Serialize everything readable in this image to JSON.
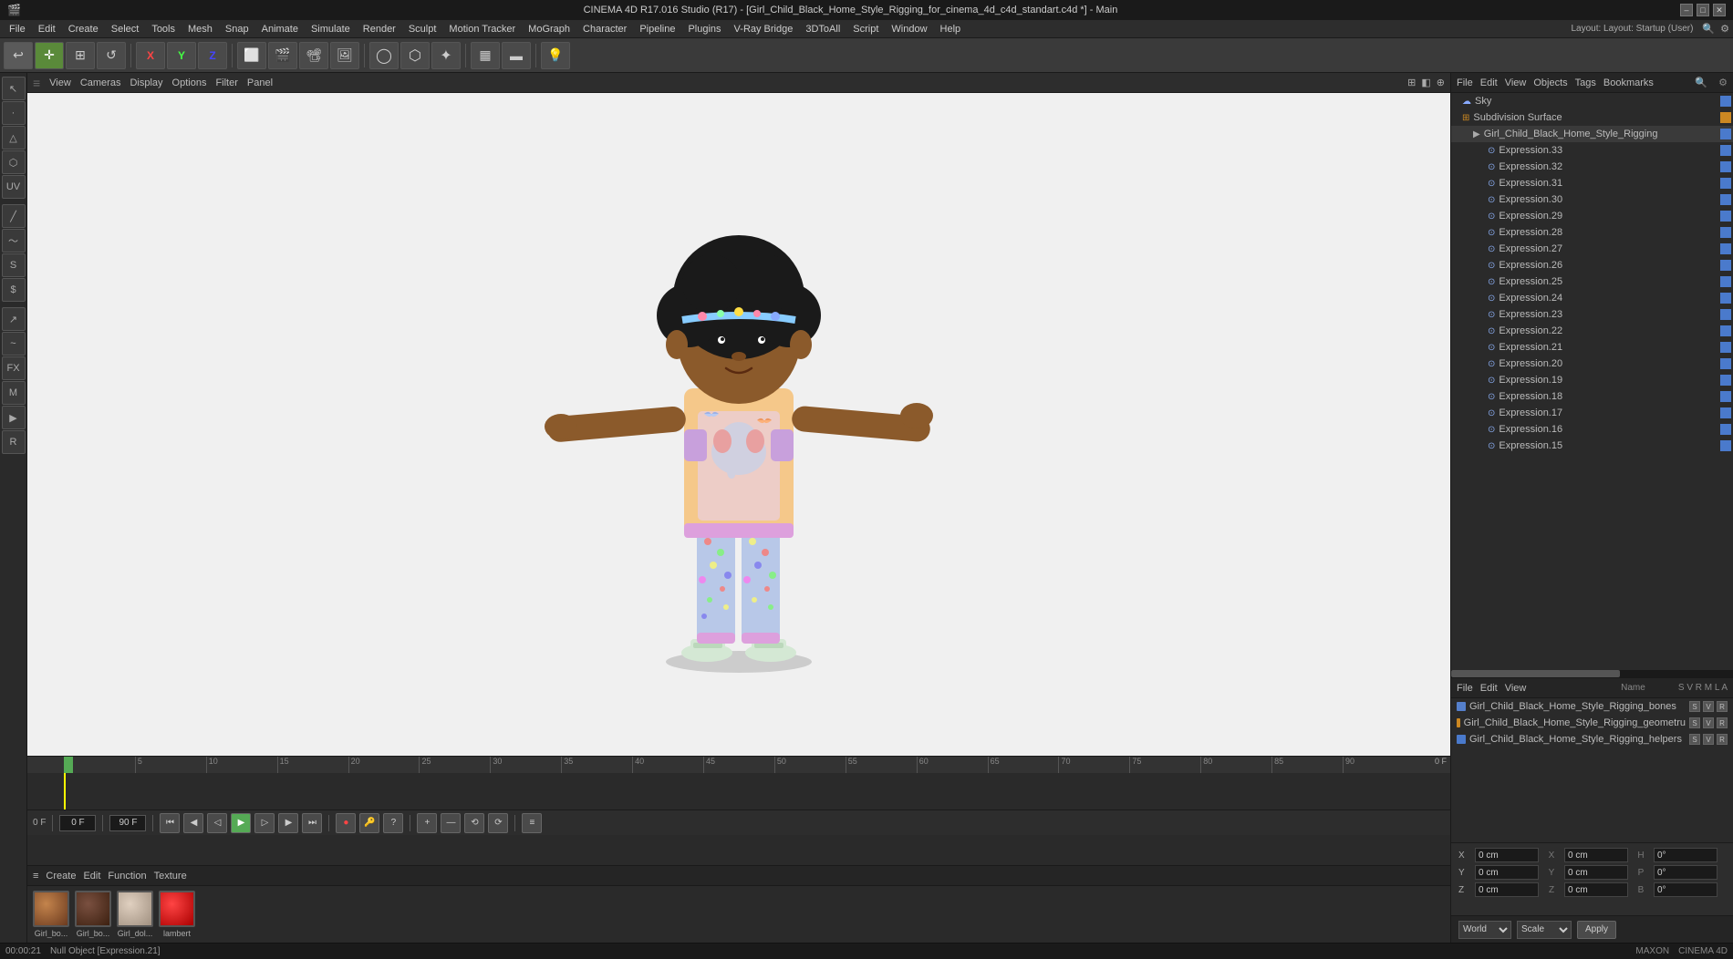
{
  "titleBar": {
    "title": "CINEMA 4D R17.016 Studio (R17) - [Girl_Child_Black_Home_Style_Rigging_for_cinema_4d_c4d_standart.c4d *] - Main",
    "controls": [
      "–",
      "□",
      "✕"
    ]
  },
  "menuBar": {
    "items": [
      "File",
      "Edit",
      "Create",
      "Select",
      "Tools",
      "Mesh",
      "Snap",
      "Animate",
      "Simulate",
      "Render",
      "Sculpt",
      "Motion Tracker",
      "MoGraph",
      "Character",
      "Pipeline",
      "Plugins",
      "V-Ray Bridge",
      "3DToAll",
      "Script",
      "Window",
      "Help"
    ]
  },
  "toolbar": {
    "layout_label": "Layout: Startup (User)"
  },
  "viewport": {
    "toolbar_items": [
      "View",
      "Cameras",
      "Display",
      "Options",
      "Filter",
      "Panel"
    ]
  },
  "timeline": {
    "frame_labels": [
      "0",
      "5",
      "10",
      "15",
      "20",
      "25",
      "30",
      "35",
      "40",
      "45",
      "50",
      "55",
      "60",
      "65",
      "70",
      "75",
      "80",
      "85",
      "90"
    ],
    "current_frame": "0 F",
    "end_frame": "90 F",
    "frame_input": "90 F"
  },
  "scenePanel": {
    "toolbar": [
      "File",
      "Edit",
      "View",
      "Objects",
      "Tags",
      "Bookmarks"
    ],
    "items": [
      {
        "label": "Sky",
        "indent": 0,
        "type": "sky",
        "badge": "blue"
      },
      {
        "label": "Subdivision Surface",
        "indent": 0,
        "type": "sub",
        "badge": "orange"
      },
      {
        "label": "Girl_Child_Black_Home_Style_Rigging",
        "indent": 1,
        "type": "group",
        "badge": "blue"
      },
      {
        "label": "Expression.33",
        "indent": 2,
        "type": "expr",
        "badge": "blue"
      },
      {
        "label": "Expression.32",
        "indent": 2,
        "type": "expr",
        "badge": "blue"
      },
      {
        "label": "Expression.31",
        "indent": 2,
        "type": "expr",
        "badge": "blue"
      },
      {
        "label": "Expression.30",
        "indent": 2,
        "type": "expr",
        "badge": "blue"
      },
      {
        "label": "Expression.29",
        "indent": 2,
        "type": "expr",
        "badge": "blue"
      },
      {
        "label": "Expression.28",
        "indent": 2,
        "type": "expr",
        "badge": "blue"
      },
      {
        "label": "Expression.27",
        "indent": 2,
        "type": "expr",
        "badge": "blue"
      },
      {
        "label": "Expression.26",
        "indent": 2,
        "type": "expr",
        "badge": "blue"
      },
      {
        "label": "Expression.25",
        "indent": 2,
        "type": "expr",
        "badge": "blue"
      },
      {
        "label": "Expression.24",
        "indent": 2,
        "type": "expr",
        "badge": "blue"
      },
      {
        "label": "Expression.23",
        "indent": 2,
        "type": "expr",
        "badge": "blue"
      },
      {
        "label": "Expression.22",
        "indent": 2,
        "type": "expr",
        "badge": "blue"
      },
      {
        "label": "Expression.21",
        "indent": 2,
        "type": "expr",
        "badge": "blue"
      },
      {
        "label": "Expression.20",
        "indent": 2,
        "type": "expr",
        "badge": "blue"
      },
      {
        "label": "Expression.19",
        "indent": 2,
        "type": "expr",
        "badge": "blue"
      },
      {
        "label": "Expression.18",
        "indent": 2,
        "type": "expr",
        "badge": "blue"
      },
      {
        "label": "Expression.17",
        "indent": 2,
        "type": "expr",
        "badge": "blue"
      },
      {
        "label": "Expression.16",
        "indent": 2,
        "type": "expr",
        "badge": "blue"
      },
      {
        "label": "Expression.15",
        "indent": 2,
        "type": "expr",
        "badge": "blue"
      }
    ]
  },
  "objectsPanel": {
    "toolbar": [
      "File",
      "Edit",
      "View"
    ],
    "columns": [
      "Name",
      "S",
      "V",
      "R",
      "M",
      "L",
      "A"
    ],
    "items": [
      {
        "label": "Girl_Child_Black_Home_Style_Rigging_bones",
        "color": "#6a8acc"
      },
      {
        "label": "Girl_Child_Black_Home_Style_Rigging_geometru",
        "color": "#cc8a2a"
      },
      {
        "label": "Girl_Child_Black_Home_Style_Rigging_helpers",
        "color": "#5a8acc"
      }
    ]
  },
  "coords": {
    "x_label": "X",
    "y_label": "Y",
    "z_label": "Z",
    "x_val": "0 cm",
    "y_val": "0 cm",
    "z_val": "0 cm",
    "h_label": "H",
    "p_label": "P",
    "b_label": "B",
    "h_val": "0°",
    "p_val": "0°",
    "b_val": "0°",
    "x2_val": "0 cm",
    "y2_val": "0 cm",
    "z2_val": "0 cm"
  },
  "bottomControls": {
    "world_label": "World",
    "scale_label": "Scale",
    "apply_label": "Apply"
  },
  "materialArea": {
    "toolbar": [
      "Create",
      "Edit",
      "Function",
      "Texture"
    ],
    "materials": [
      {
        "label": "Girl_bo...",
        "color": "#8B5E3C"
      },
      {
        "label": "Girl_bo...",
        "color": "#5C4033"
      },
      {
        "label": "Girl_dol...",
        "color": "#aaa"
      },
      {
        "label": "lambert",
        "color": "#cc2222"
      }
    ]
  },
  "statusBar": {
    "time": "00:00:21",
    "message": "Null Object [Expression.21]"
  }
}
